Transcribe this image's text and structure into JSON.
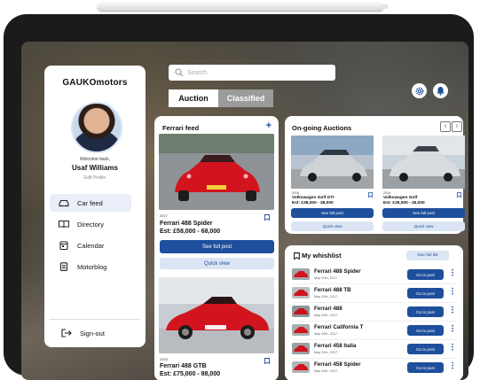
{
  "brand": {
    "logo_text": "GAUKOmotors"
  },
  "profile": {
    "welcome": "Welcome back,",
    "name": "Usaf Williams",
    "edit_label": "Edit Profile"
  },
  "nav": {
    "items": [
      {
        "label": "Car feed",
        "icon": "car-icon",
        "active": true
      },
      {
        "label": "Directory",
        "icon": "book-icon",
        "active": false
      },
      {
        "label": "Calendar",
        "icon": "calendar-icon",
        "active": false
      },
      {
        "label": "Motorblog",
        "icon": "document-icon",
        "active": false
      }
    ],
    "signout": "Sign-out"
  },
  "search": {
    "placeholder": "Search"
  },
  "tabs": [
    {
      "label": "Auction",
      "selected": true
    },
    {
      "label": "Classified",
      "selected": false
    }
  ],
  "feed": {
    "title": "Ferrari feed",
    "posts": [
      {
        "year": "2017",
        "name": "Ferrari 488 Spider",
        "price": "Est: £58,000 - 68,000",
        "primary_btn": "See full post",
        "secondary_btn": "Quick view"
      },
      {
        "year": "2016",
        "name": "Ferrari 488 GTB",
        "price": "Est: £75,000 - 88,000"
      }
    ]
  },
  "auctions": {
    "title": "On-going Auctions",
    "items": [
      {
        "year": "2018",
        "name": "Volkswagen Golf GTI",
        "price": "Est: £38,000 - 48,000",
        "primary_btn": "See full post",
        "secondary_btn": "Quick view"
      },
      {
        "year": "2016",
        "name": "Volkswagen Golf",
        "price": "Est: £35,000 - 45,000",
        "primary_btn": "See full post",
        "secondary_btn": "Quick view"
      }
    ]
  },
  "whishlist": {
    "title": "My whishlist",
    "see_full": "See full list",
    "rows": [
      {
        "name": "Ferrari 488 Spider",
        "date": "May 20th, 2017.",
        "btn": "Go to post"
      },
      {
        "name": "Ferrari 488 TB",
        "date": "May 20th, 2017.",
        "btn": "Go to post"
      },
      {
        "name": "Ferrari 488",
        "date": "May 20th, 2017.",
        "btn": "Go to post"
      },
      {
        "name": "Ferrari California T",
        "date": "May 20th, 2017.",
        "btn": "Go to post"
      },
      {
        "name": "Ferrari 458 Italia",
        "date": "May 20th, 2017.",
        "btn": "Go to post"
      },
      {
        "name": "Ferrari 458 Spider",
        "date": "May 20th, 2017.",
        "btn": "Go to post"
      }
    ]
  },
  "colors": {
    "accent": "#1e4f9c",
    "accent_light": "#dbe5f4",
    "ferrari_red": "#d2141e"
  }
}
